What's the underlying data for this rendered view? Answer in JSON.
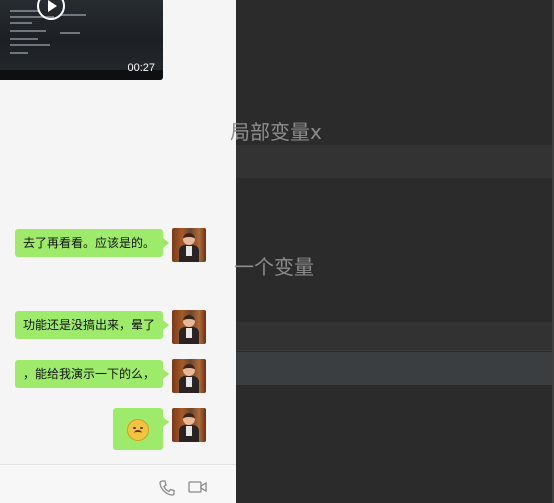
{
  "video": {
    "duration": "00:27"
  },
  "messages": [
    {
      "text": "去了再看看。应该是的。"
    },
    {
      "text": "功能还是没搞出来，晕了"
    },
    {
      "text": "，能给我演示一下的么，"
    }
  ],
  "emoji": {
    "name": "sad-face-emoji"
  },
  "footer": {
    "phone_icon": "phone-icon",
    "video_icon": "video-call-icon"
  },
  "editor": {
    "line1": "局部变量x",
    "line2": "一个变量"
  }
}
